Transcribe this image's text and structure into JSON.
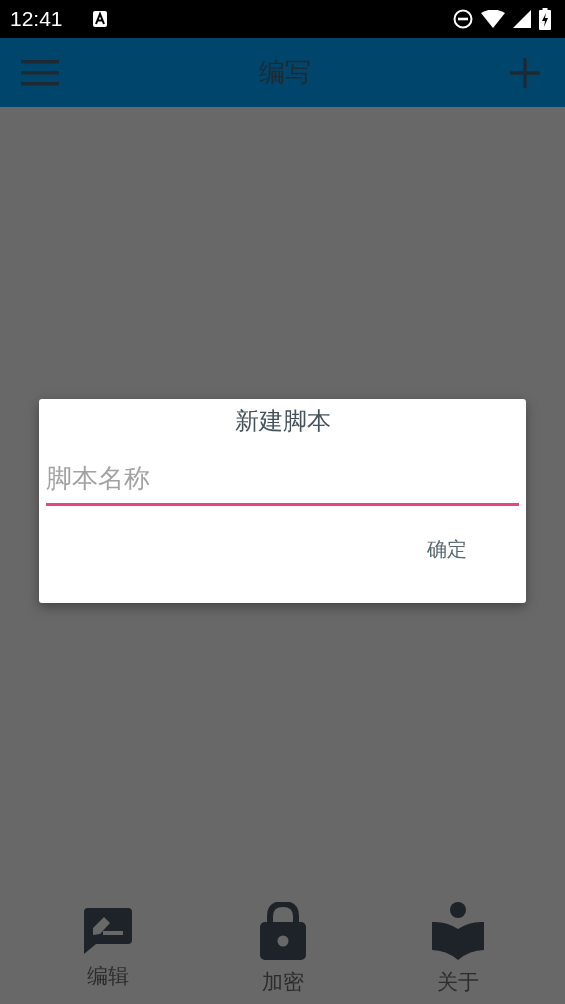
{
  "status_bar": {
    "time": "12:41"
  },
  "app_bar": {
    "title": "编写"
  },
  "dialog": {
    "title": "新建脚本",
    "field": {
      "placeholder": "脚本名称"
    },
    "buttons": [
      "确定"
    ]
  },
  "bottom_nav": [
    {
      "kind": "edit",
      "label": "编辑"
    },
    {
      "kind": "lock",
      "label": "加密"
    },
    {
      "kind": "about",
      "label": "关于"
    }
  ]
}
